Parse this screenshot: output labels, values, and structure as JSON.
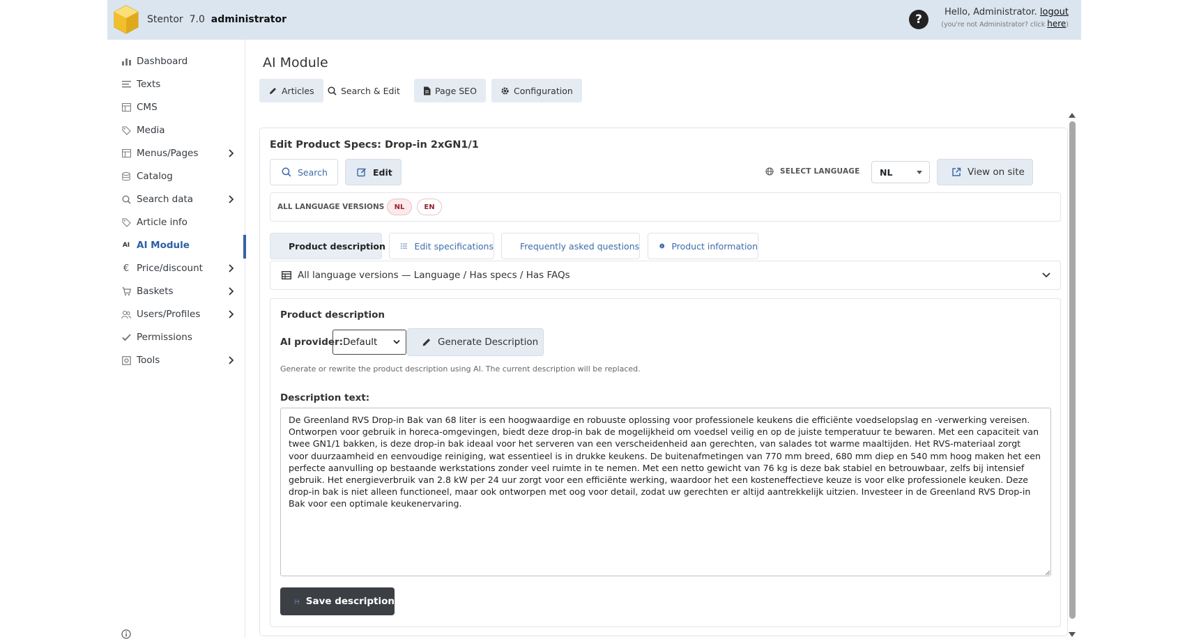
{
  "header": {
    "brand_name": "Stentor",
    "version": "7.0",
    "role": "administrator",
    "hello_text": "Hello, Administrator.",
    "logout_label": "logout",
    "not_user_prefix": "(you're not Administrator? click",
    "here_label": "here",
    "not_user_suffix": ")",
    "help_label": "?"
  },
  "sidebar": {
    "items": [
      {
        "label": "Dashboard",
        "icon": "bar-chart-icon"
      },
      {
        "label": "Texts",
        "icon": "text-lines-icon"
      },
      {
        "label": "CMS",
        "icon": "layout-icon"
      },
      {
        "label": "Media",
        "icon": "tag-icon"
      },
      {
        "label": "Menus/Pages",
        "icon": "layout-icon",
        "expandable": true
      },
      {
        "label": "Catalog",
        "icon": "database-icon"
      },
      {
        "label": "Search data",
        "icon": "search-icon",
        "expandable": true
      },
      {
        "label": "Article info",
        "icon": "tag-icon"
      },
      {
        "label": "AI Module",
        "icon": "ai-icon",
        "active": true
      },
      {
        "label": "Price/discount",
        "icon": "euro-icon",
        "expandable": true
      },
      {
        "label": "Baskets",
        "icon": "cart-icon",
        "expandable": true
      },
      {
        "label": "Users/Profiles",
        "icon": "users-icon",
        "expandable": true
      },
      {
        "label": "Permissions",
        "icon": "check-icon"
      },
      {
        "label": "Tools",
        "icon": "tools-icon",
        "expandable": true
      }
    ],
    "ai_glyph": "AI",
    "euro_glyph": "€"
  },
  "main": {
    "title": "AI Module",
    "tabs": [
      {
        "label": "Articles"
      },
      {
        "label": "Search & Edit"
      },
      {
        "label": "Page SEO"
      },
      {
        "label": "Configuration"
      }
    ]
  },
  "editor": {
    "title": "Edit Product Specs: Drop-in 2xGN1/1",
    "search_label": "Search",
    "edit_label": "Edit",
    "select_language_label": "SELECT LANGUAGE",
    "selected_language": "NL",
    "view_on_site_label": "View on site",
    "all_language_versions_label": "ALL LANGUAGE VERSIONS",
    "languages": [
      "NL",
      "EN"
    ],
    "subtabs": [
      {
        "label": "Product description",
        "active": true
      },
      {
        "label": "Edit specifications"
      },
      {
        "label": "Frequently asked questions"
      },
      {
        "label": "Product information"
      }
    ],
    "accordion_label": "All language versions — Language / Has specs / Has FAQs"
  },
  "description_panel": {
    "title": "Product description",
    "ai_provider_label": "AI provider:",
    "ai_provider_value": "Default",
    "generate_label": "Generate Description",
    "help_text": "Generate or rewrite the product description using AI. The current description will be replaced.",
    "description_label": "Description text:",
    "description_text": "De Greenland RVS Drop-in Bak van 68 liter is een hoogwaardige en robuuste oplossing voor professionele keukens die efficiënte voedselopslag en -verwerking vereisen. Ontworpen voor gebruik in horeca-omgevingen, biedt deze drop-in bak de mogelijkheid om voedsel veilig en op de juiste temperatuur te bewaren. Met een capaciteit van twee GN1/1 bakken, is deze drop-in bak ideaal voor het serveren van een verscheidenheid aan gerechten, van salades tot warme maaltijden. Het RVS-materiaal zorgt voor duurzaamheid en eenvoudige reiniging, wat essentieel is in drukke keukens. De buitenafmetingen van 770 mm breed, 680 mm diep en 540 mm hoog maken het een perfecte aanvulling op bestaande werkstations zonder veel ruimte in te nemen. Met een netto gewicht van 76 kg is deze bak stabiel en betrouwbaar, zelfs bij intensief gebruik. Het energieverbruik van 2.8 kW per 24 uur zorgt voor een efficiënte werking, waardoor het een kosteneffectieve keuze is voor elke professionele keuken. Deze drop-in bak is niet alleen functioneel, maar ook ontworpen met oog voor detail, zodat uw gerechten er altijd aantrekkelijk uitzien. Investeer in de Greenland RVS Drop-in Bak voor een optimale keukenervaring.",
    "save_label": "Save description"
  },
  "colors": {
    "topbar": "#dbe5ef",
    "accent": "#3563a8",
    "badge_red": "#9c1f2e",
    "save_button": "#3c3f44"
  }
}
